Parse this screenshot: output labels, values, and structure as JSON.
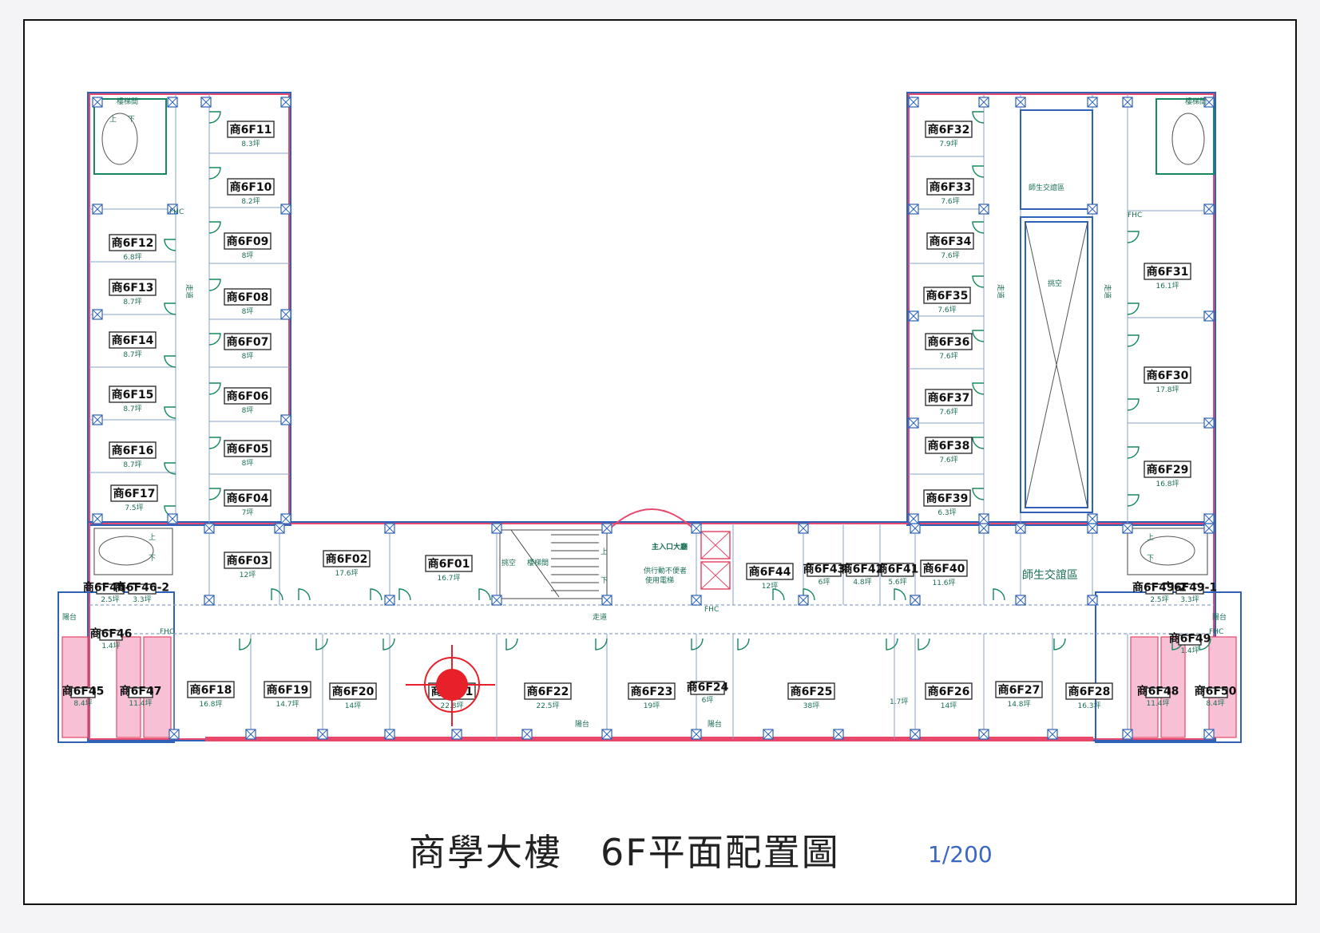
{
  "title": "商學大樓　6F平面配置圖",
  "scale": "1/200",
  "corridor_label": "走道",
  "stair_label": "樓梯間",
  "void_label": "挑空",
  "lounge_label": "師生交誼區",
  "lounge_label_small": "師生交誼區",
  "entrance_label": "主入口大廳",
  "elevator_note_1": "供行動不便者",
  "elevator_note_2": "使用電梯",
  "balcony_label": "陽台",
  "fhc_label": "FHC",
  "up_label": "上",
  "down_label": "下",
  "misc_area_label": "1.7坪",
  "colors": {
    "exterior_wall": "#e8486a",
    "structure": "#2d62b8",
    "door": "#16885f",
    "marker": "#e8202a"
  },
  "rooms": [
    {
      "id": "商6F01",
      "area": "16.7坪"
    },
    {
      "id": "商6F02",
      "area": "17.6坪"
    },
    {
      "id": "商6F03",
      "area": "12坪"
    },
    {
      "id": "商6F04",
      "area": "7坪"
    },
    {
      "id": "商6F05",
      "area": "8坪"
    },
    {
      "id": "商6F06",
      "area": "8坪"
    },
    {
      "id": "商6F07",
      "area": "8坪"
    },
    {
      "id": "商6F08",
      "area": "8坪"
    },
    {
      "id": "商6F09",
      "area": "8坪"
    },
    {
      "id": "商6F10",
      "area": "8.2坪"
    },
    {
      "id": "商6F11",
      "area": "8.3坪"
    },
    {
      "id": "商6F12",
      "area": "6.8坪"
    },
    {
      "id": "商6F13",
      "area": "8.7坪"
    },
    {
      "id": "商6F14",
      "area": "8.7坪"
    },
    {
      "id": "商6F15",
      "area": "8.7坪"
    },
    {
      "id": "商6F16",
      "area": "8.7坪"
    },
    {
      "id": "商6F17",
      "area": "7.5坪"
    },
    {
      "id": "商6F18",
      "area": "16.8坪"
    },
    {
      "id": "商6F19",
      "area": "14.7坪"
    },
    {
      "id": "商6F20",
      "area": "14坪"
    },
    {
      "id": "商6F21",
      "area": "22.8坪"
    },
    {
      "id": "商6F22",
      "area": "22.5坪"
    },
    {
      "id": "商6F23",
      "area": "19坪"
    },
    {
      "id": "商6F24",
      "area": "6坪"
    },
    {
      "id": "商6F25",
      "area": "38坪"
    },
    {
      "id": "商6F26",
      "area": "14坪"
    },
    {
      "id": "商6F27",
      "area": "14.8坪"
    },
    {
      "id": "商6F28",
      "area": "16.3坪"
    },
    {
      "id": "商6F29",
      "area": "16.8坪"
    },
    {
      "id": "商6F30",
      "area": "17.8坪"
    },
    {
      "id": "商6F31",
      "area": "16.1坪"
    },
    {
      "id": "商6F32",
      "area": "7.9坪"
    },
    {
      "id": "商6F33",
      "area": "7.6坪"
    },
    {
      "id": "商6F34",
      "area": "7.6坪"
    },
    {
      "id": "商6F35",
      "area": "7.6坪"
    },
    {
      "id": "商6F36",
      "area": "7.6坪"
    },
    {
      "id": "商6F37",
      "area": "7.6坪"
    },
    {
      "id": "商6F38",
      "area": "7.6坪"
    },
    {
      "id": "商6F39",
      "area": "6.3坪"
    },
    {
      "id": "商6F40",
      "area": "11.6坪"
    },
    {
      "id": "商6F41",
      "area": "5.6坪"
    },
    {
      "id": "商6F42",
      "area": "4.8坪"
    },
    {
      "id": "商6F43",
      "area": "6坪"
    },
    {
      "id": "商6F44",
      "area": "12坪"
    },
    {
      "id": "商6F45",
      "area": "8.4坪"
    },
    {
      "id": "商6F46",
      "area": "1.4坪"
    },
    {
      "id": "商6F47",
      "area": "11.4坪"
    },
    {
      "id": "商6F46-1",
      "area": "2.5坪"
    },
    {
      "id": "商6F46-2",
      "area": "3.3坪"
    },
    {
      "id": "商6F48",
      "area": "11.4坪"
    },
    {
      "id": "商6F49",
      "area": "1.4坪"
    },
    {
      "id": "商6F50",
      "area": "8.4坪"
    },
    {
      "id": "商6F49-1",
      "area": "3.3坪"
    },
    {
      "id": "商6F49-2",
      "area": "2.5坪"
    }
  ]
}
